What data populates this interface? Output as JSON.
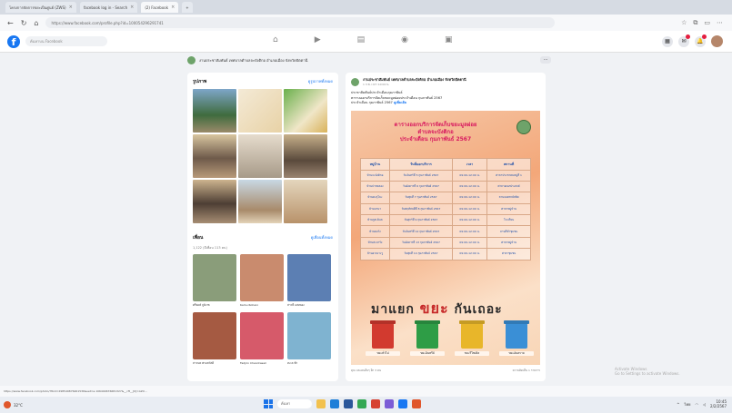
{
  "browser": {
    "tabs": [
      {
        "label": "โครงการจัดการขยะเป็นศูนย์ (ZWS)",
        "active": false
      },
      {
        "label": "facebook log in - Search",
        "active": false
      },
      {
        "label": "(2) Facebook",
        "active": true
      }
    ],
    "new_tab_label": "+",
    "url": "https://www.facebook.com/profile.php?id=100054296291741",
    "status_url": "https://www.facebook.com/photo/?fbid=298549876461536&set=a.106494676681327&__cft__[0]=AZX..."
  },
  "facebook": {
    "search_placeholder": "ค้นหาบน Facebook",
    "page_name": "งานประชาสัมพันธ์ เทศบาลตำบลจะบังติกอ อำเภอเมือง จังหวัดปัตตานี",
    "photos_section": {
      "title": "รูปภาพ",
      "link": "ดูรูปภาพทั้งหมด"
    },
    "friends_section": {
      "title": "เพื่อน",
      "count": "1,122 (มีเพื่อน 113 คน)",
      "link": "ดูเพื่อนทั้งหมด"
    },
    "friends": [
      {
        "name": "ศรีพงษ์ ภูมิเวช",
        "color": "#8a9d7a"
      },
      {
        "name": "Kamu Rohani",
        "color": "#c98b6e"
      },
      {
        "name": "สาวที่ แสงทอง",
        "color": "#5c7fb3"
      },
      {
        "name": "สาวนท พรมสวัสดิ์",
        "color": "#a55a42"
      },
      {
        "name": "Fadjrin Chandrasari",
        "color": "#d65a6a"
      },
      {
        "name": "ทะเล ฟ้า",
        "color": "#7fb3d0"
      }
    ]
  },
  "post": {
    "author": "งานประชาสัมพันธ์ เทศบาลตำบลจะบังติกอ อำเภอเมือง จังหวัดปัตตานี",
    "time": "1 ก.พ. เวลา 10:00 น.",
    "text_lines": [
      "ประชาสัมพันธ์ประจำเดือนกุมภาพันธ์",
      "ตารางออกบริการจัดเก็บขยะมูลฝอยประจำเดือน กุมภาพันธ์ 2567",
      "ประจำเดือน กุมภาพันธ์ 2567"
    ],
    "see_more": "ดูเพิ่มเติม",
    "poster": {
      "title_lines": [
        "ตารางออกบริการจัดเก็บขยะมูลฝอย",
        "ตำบลจะบังติกอ",
        "ประจำเดือน กุมภาพันธ์ 2567"
      ],
      "headers": [
        "หมู่บ้าน",
        "วันที่ออกบริการ",
        "เวลา",
        "สถานที่"
      ],
      "rows": [
        [
          "บ้านจะบังติกอ",
          "วันจันทร์ที่ 5 กุมภาพันธ์ 2567",
          "09:00-12:00 น.",
          "ศาลาประชาคมหมู่ที่ 1"
        ],
        [
          "บ้านปากคลอง",
          "วันอังคารที่ 6 กุมภาพันธ์ 2567",
          "09:00-12:00 น.",
          "ศาลาอเนกประสงค์"
        ],
        [
          "บ้านตะลุโบะ",
          "วันพุธที่ 7 กุมภาพันธ์ 2567",
          "09:00-12:00 น.",
          "ลานจอดรถมัสยิด"
        ],
        [
          "บ้านบานา",
          "วันพฤหัสบดีที่ 8 กุมภาพันธ์ 2567",
          "09:00-12:00 น.",
          "ศาลาหมู่บ้าน"
        ],
        [
          "บ้านรูสะมิแล",
          "วันศุกร์ที่ 9 กุมภาพันธ์ 2567",
          "09:00-12:00 น.",
          "โรงเรียน"
        ],
        [
          "บ้านยะกัง",
          "วันจันทร์ที่ 12 กุมภาพันธ์ 2567",
          "09:00-12:00 น.",
          "ลานกีฬาชุมชน"
        ],
        [
          "บ้านสะบารัง",
          "วันอังคารที่ 13 กุมภาพันธ์ 2567",
          "09:00-12:00 น.",
          "ศาลาหมู่บ้าน"
        ],
        [
          "บ้านอาเนาะรู",
          "วันพุธที่ 14 กุมภาพันธ์ 2567",
          "09:00-12:00 น.",
          "ศาลาชุมชน"
        ]
      ],
      "slogan_a": "มาแยก",
      "slogan_b": "ขยะ",
      "slogan_c": "กันเถอะ",
      "bins": [
        {
          "label": "ขยะทั่วไป",
          "color": "#d23a2f"
        },
        {
          "label": "ขยะอินทรีย์",
          "color": "#2e9d46"
        },
        {
          "label": "ขยะรีไซเคิล",
          "color": "#e8b62a"
        },
        {
          "label": "ขยะอันตราย",
          "color": "#3a8fd6"
        }
      ]
    },
    "reactions": "คุณ และคนอื่นๆ อีก 3 คน",
    "comments": "ความคิดเห็น 1 รายการ"
  },
  "taskbar": {
    "weather": "32°C",
    "search": "ค้นหา",
    "clock": "10:45",
    "date": "2/2/2567",
    "lang": "ไทย"
  },
  "watermark": [
    "Activate Windows",
    "Go to Settings to activate Windows."
  ]
}
